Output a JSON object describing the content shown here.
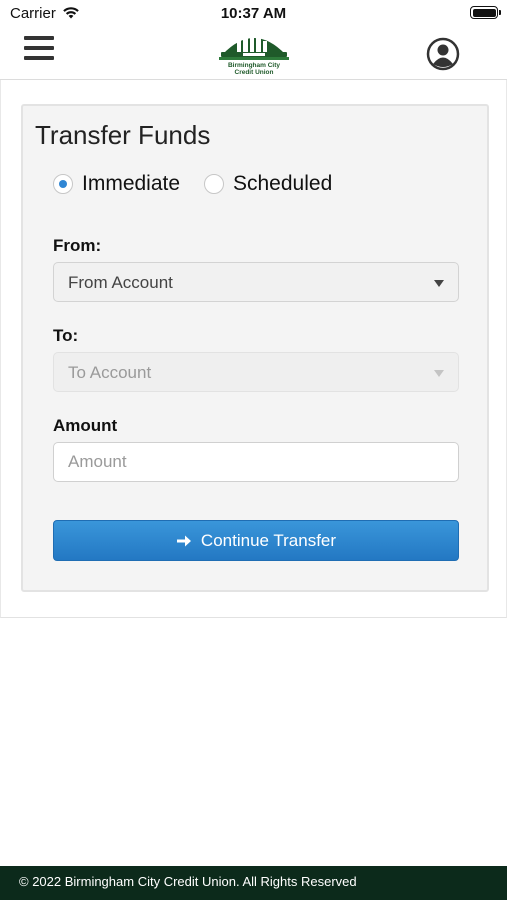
{
  "status_bar": {
    "carrier": "Carrier",
    "time": "10:37 AM"
  },
  "header": {
    "menu_icon": "hamburger-menu-icon",
    "logo": {
      "line1": "Birmingham City",
      "line2": "Credit Union"
    },
    "profile_icon": "user-circle-icon"
  },
  "transfer_form": {
    "title": "Transfer Funds",
    "mode_options": [
      {
        "label": "Immediate",
        "checked": true
      },
      {
        "label": "Scheduled",
        "checked": false
      }
    ],
    "from": {
      "label": "From:",
      "selected": "From Account"
    },
    "to": {
      "label": "To:",
      "selected": "To Account",
      "disabled": true
    },
    "amount": {
      "label": "Amount",
      "placeholder": "Amount",
      "value": ""
    },
    "submit_label": "Continue Transfer",
    "submit_icon": "arrow-right-icon"
  },
  "footer": {
    "text": "© 2022 Birmingham City Credit Union. All Rights Reserved"
  },
  "colors": {
    "accent": "#2f86d4",
    "button": "#2a80c9",
    "footer_bg": "#0c2a1b",
    "brand_green": "#1f5a2a"
  }
}
